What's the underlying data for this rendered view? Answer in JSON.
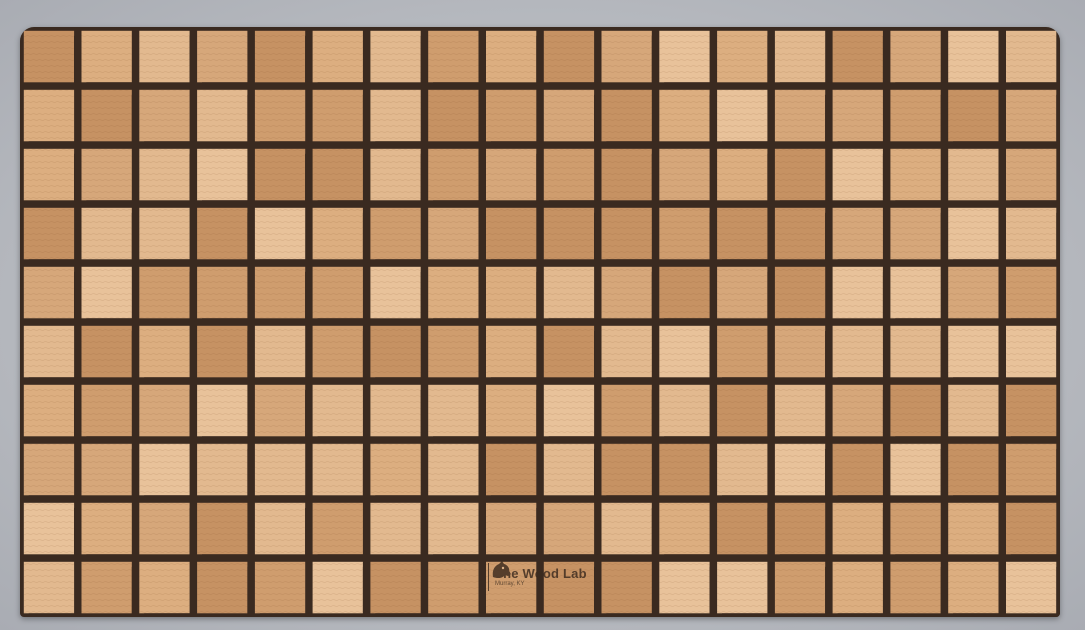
{
  "photo": {
    "subject": "end-grain cutting board with basket weave pattern",
    "colors": {
      "background": "#b9bcc2",
      "wood_light": "#e2b98f",
      "wood_mid": "#d6a77a",
      "wood_dark": "#c69263",
      "walnut_strip": "#3a2a20"
    }
  },
  "logo": {
    "title": "The Wood Lab",
    "subtitle": "Murray, KY",
    "icon": "dog-head-icon"
  }
}
